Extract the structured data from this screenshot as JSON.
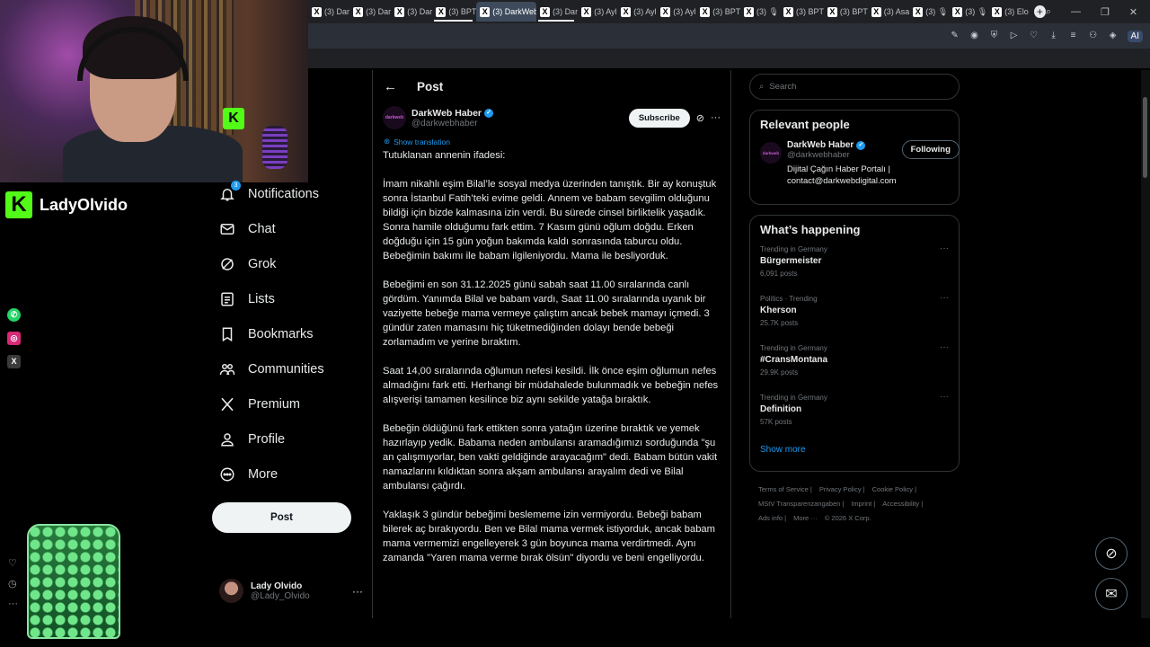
{
  "browser": {
    "tabs": [
      {
        "label": "(3) Dar",
        "active": false,
        "playing": false
      },
      {
        "label": "(3) Dar",
        "active": false,
        "playing": false
      },
      {
        "label": "(3) Dar",
        "active": false,
        "playing": false
      },
      {
        "label": "(3) BPT",
        "active": false,
        "playing": true
      },
      {
        "label": "(3) DarkWeb",
        "active": true,
        "playing": false
      },
      {
        "label": "(3) Dar",
        "active": false,
        "playing": true
      },
      {
        "label": "(3) Ayl",
        "active": false,
        "playing": false
      },
      {
        "label": "(3) Ayl",
        "active": false,
        "playing": false
      },
      {
        "label": "(3) Ayl",
        "active": false,
        "playing": false
      },
      {
        "label": "(3) BPT",
        "active": false,
        "playing": false
      },
      {
        "label": "(3) 🎙",
        "active": false,
        "playing": false
      },
      {
        "label": "(3) BPT",
        "active": false,
        "playing": false
      },
      {
        "label": "(3) BPT",
        "active": false,
        "playing": false
      },
      {
        "label": "(3) Asa",
        "active": false,
        "playing": false
      },
      {
        "label": "(3) 🎙",
        "active": false,
        "playing": false
      },
      {
        "label": "(3) 🎙",
        "active": false,
        "playing": false
      },
      {
        "label": "(3) Elo",
        "active": false,
        "playing": false
      }
    ],
    "ai_label": "AI"
  },
  "stream": {
    "channel_name": "LadyOlvido",
    "kick_letter": "K"
  },
  "nav": {
    "items": [
      {
        "key": "notifications",
        "label": "Notifications",
        "badge": "3"
      },
      {
        "key": "chat",
        "label": "Chat"
      },
      {
        "key": "grok",
        "label": "Grok"
      },
      {
        "key": "lists",
        "label": "Lists"
      },
      {
        "key": "bookmarks",
        "label": "Bookmarks"
      },
      {
        "key": "communities",
        "label": "Communities"
      },
      {
        "key": "premium",
        "label": "Premium"
      },
      {
        "key": "profile",
        "label": "Profile"
      },
      {
        "key": "more",
        "label": "More"
      }
    ],
    "post_button": "Post",
    "account": {
      "name": "Lady Olvido",
      "handle": "@Lady_Olvido"
    }
  },
  "main": {
    "title": "Post",
    "author": {
      "name": "DarkWeb Haber",
      "handle": "@darkwebhaber",
      "avatar_text": "darkweb"
    },
    "subscribe_label": "Subscribe",
    "show_translation": "Show translation",
    "paragraphs": [
      "Tutuklanan annenin ifadesi:",
      "İmam nikahlı eşim Bilal’le sosyal medya üzerinden tanıştık. Bir ay konuştuk sonra İstanbul Fatih’teki evime geldi. Annem ve babam sevgilim olduğunu bildiği için bizde kalmasına izin verdi. Bu sürede cinsel birliktelik yaşadık. Sonra hamile olduğumu fark ettim. 7 Kasım günü oğlum doğdu. Erken doğduğu için 15 gün yoğun bakımda kaldı sonrasında taburcu oldu. Bebeğimin bakımı ile babam ilgileniyordu. Mama ile besliyorduk.",
      "Bebeğimi en son 31.12.2025 günü sabah saat 11.00 sıralarında canlı gördüm. Yanımda Bilal ve babam vardı, Saat 11.00 sıralarında uyanık bir vaziyette bebeğe mama vermeye çalıştım ancak bebek mamayı içmedi. 3 gündür zaten mamasını hiç tüketmediğinden dolayı bende bebeği zorlamadım ve yerine bıraktım.",
      "Saat 14,00 sıralarında oğlumun nefesi kesildi. İlk önce eşim oğlumun nefes almadığını fark etti. Herhangi bir müdahalede bulunmadık ve bebeğin nefes alışverişi tamamen kesilince biz aynı sekilde yatağa bıraktık.",
      "Bebeğin öldüğünü fark ettikten sonra yatağın üzerine bıraktık ve yemek hazırlayıp yedik. Babama neden ambulansı aramadığımızı sorduğunda \"şu an çalışmıyorlar, ben vakti geldiğinde arayacağım\" dedi. Babam bütün vakit namazlarını kıldıktan sonra akşam ambulansı arayalım dedi ve Bilal ambulansı çağırdı.",
      "Yaklaşık 3 gündür bebeğimi beslememe izin vermiyordu. Bebeği babam bilerek aç bırakıyordu. Ben ve Bilal mama vermek istiyorduk, ancak babam mama vermemizi engelleyerek 3 gün boyunca mama verdirtmedi. Aynı zamanda \"Yaren mama verme bırak ölsün\" diyordu ve beni engelliyordu."
    ]
  },
  "right": {
    "search_placeholder": "Search",
    "relevant_title": "Relevant people",
    "relevant_person": {
      "name": "DarkWeb Haber",
      "handle": "@darkwebhaber",
      "bio_line1": "Dijital Çağın Haber Portalı |",
      "bio_line2": "contact@darkwebdigital.com",
      "follow_label": "Following",
      "avatar_text": "darkweb"
    },
    "happening_title": "What’s happening",
    "trends": [
      {
        "meta": "Trending in Germany",
        "name": "Bürgermeister",
        "posts": "6,091 posts"
      },
      {
        "meta": "Politics · Trending",
        "name": "Kherson",
        "posts": "25.7K posts"
      },
      {
        "meta": "Trending in Germany",
        "name": "#CransMontana",
        "posts": "29.9K posts"
      },
      {
        "meta": "Trending in Germany",
        "name": "Definition",
        "posts": "57K posts"
      }
    ],
    "show_more": "Show more",
    "footer": {
      "line1": [
        "Terms of Service |",
        "Privacy Policy |",
        "Cookie Policy |"
      ],
      "line2": [
        "MStV Transparenzangaben |",
        "Imprint |",
        "Accessibility |"
      ],
      "line3": [
        "Ads info |",
        "More ···",
        "© 2026 X Corp."
      ]
    }
  },
  "colors": {
    "accent": "#1d9bf0",
    "kick_green": "#53fc18",
    "background": "#000000"
  }
}
